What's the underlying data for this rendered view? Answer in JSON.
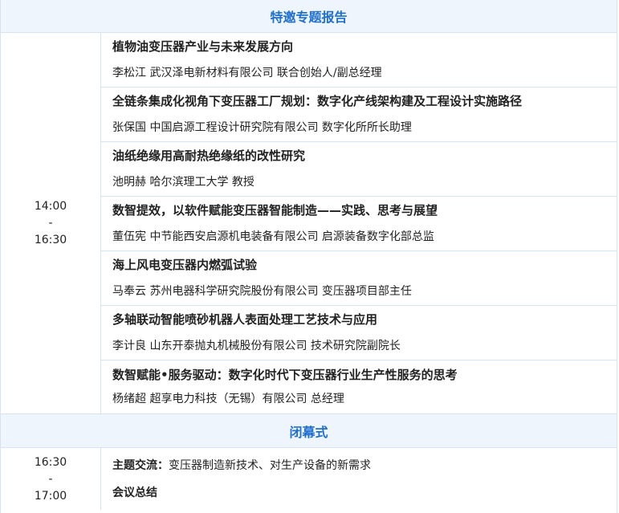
{
  "section_main": {
    "title": "特邀专题报告"
  },
  "session_main": {
    "time_start": "14:00",
    "time_sep": "-",
    "time_end": "16:30",
    "talks": [
      {
        "title": "植物油变压器产业与未来发展方向",
        "speaker": "李松江  武汉泽电新材料有限公司  联合创始人/副总经理"
      },
      {
        "title": "全链条集成化视角下变压器工厂规划：数字化产线架构建及工程设计实施路径",
        "speaker": "张保国  中国启源工程设计研究院有限公司  数字化所所长助理"
      },
      {
        "title": "油纸绝缘用高耐热绝缘纸的改性研究",
        "speaker": "池明赫  哈尔滨理工大学  教授"
      },
      {
        "title": "数智提效，以软件赋能变压器智能制造——实践、思考与展望",
        "speaker": "董伍宪  中节能西安启源机电装备有限公司  启源装备数字化部总监"
      },
      {
        "title": "海上风电变压器内燃弧试验",
        "speaker": "马奉云  苏州电器科学研究院股份有限公司  变压器项目部主任"
      },
      {
        "title": "多轴联动智能喷砂机器人表面处理工艺技术与应用",
        "speaker": "李计良  山东开泰抛丸机械股份有限公司  技术研究院副院长"
      },
      {
        "title": "数智赋能•服务驱动：数字化时代下变压器行业生产性服务的思考",
        "speaker": "杨绪超  超享电力科技（无锡）有限公司  总经理"
      }
    ]
  },
  "section_closing": {
    "title": "闭幕式"
  },
  "session_closing": {
    "time_start": "16:30",
    "time_sep": "-",
    "time_end": "17:00",
    "item1_label": "主题交流：",
    "item1_text": "变压器制造新技术、对生产设备的新需求",
    "item2_label": "会议总结"
  }
}
